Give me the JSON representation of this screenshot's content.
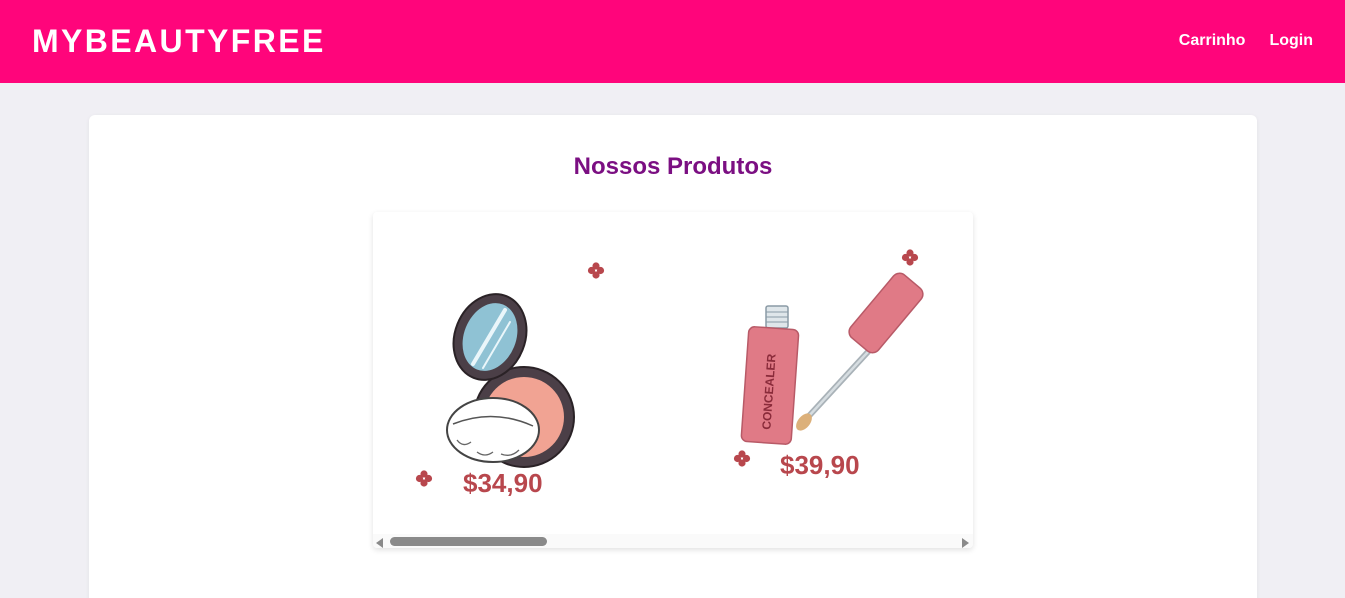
{
  "header": {
    "brand": "MYBEAUTYFREE",
    "nav": {
      "cart_label": "Carrinho",
      "login_label": "Login"
    }
  },
  "main": {
    "title": "Nossos Produtos",
    "products": [
      {
        "image_icon": "blush-compact-icon",
        "price": "$34,90"
      },
      {
        "image_icon": "concealer-icon",
        "tube_label": "CONCEALER",
        "price": "$39,90"
      }
    ]
  },
  "colors": {
    "header_bg": "#ff057b",
    "page_bg": "#f0eff4",
    "title": "#7b0f82",
    "price": "#b8474d",
    "product_pink": "#e07a86"
  }
}
